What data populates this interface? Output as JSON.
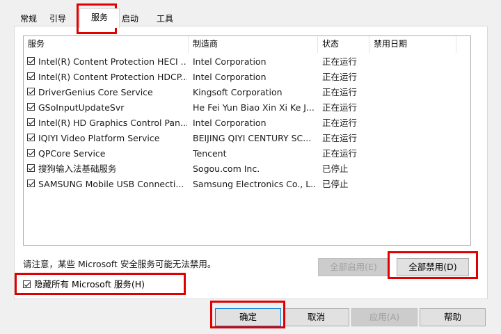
{
  "tabs": [
    {
      "label": "常规",
      "active": false
    },
    {
      "label": "引导",
      "active": false
    },
    {
      "label": "服务",
      "active": true
    },
    {
      "label": "启动",
      "active": false
    },
    {
      "label": "工具",
      "active": false
    }
  ],
  "columns": {
    "service": "服务",
    "manufacturer": "制造商",
    "status": "状态",
    "disabled_date": "禁用日期"
  },
  "services": [
    {
      "name": "Intel(R) Content Protection HECI ...",
      "manufacturer": "Intel Corporation",
      "status": "正在运行",
      "checked": true
    },
    {
      "name": "Intel(R) Content Protection HDCP...",
      "manufacturer": "Intel Corporation",
      "status": "正在运行",
      "checked": true
    },
    {
      "name": "DriverGenius Core Service",
      "manufacturer": "Kingsoft Corporation",
      "status": "正在运行",
      "checked": true
    },
    {
      "name": "GSoInputUpdateSvr",
      "manufacturer": "He Fei Yun Biao Xin Xi Ke J...",
      "status": "正在运行",
      "checked": true
    },
    {
      "name": "Intel(R) HD Graphics Control Pan...",
      "manufacturer": "Intel Corporation",
      "status": "正在运行",
      "checked": true
    },
    {
      "name": "IQIYI Video Platform Service",
      "manufacturer": "BEIJING QIYI CENTURY SC...",
      "status": "正在运行",
      "checked": true
    },
    {
      "name": "QPCore Service",
      "manufacturer": "Tencent",
      "status": "正在运行",
      "checked": true
    },
    {
      "name": "搜狗输入法基础服务",
      "manufacturer": "Sogou.com Inc.",
      "status": "已停止",
      "checked": true
    },
    {
      "name": "SAMSUNG Mobile USB Connecti...",
      "manufacturer": "Samsung Electronics Co., L...",
      "status": "已停止",
      "checked": true
    }
  ],
  "notice": "请注意，某些 Microsoft 安全服务可能无法禁用。",
  "buttons": {
    "enable_all": "全部启用(E)",
    "disable_all": "全部禁用(D)",
    "ok": "确定",
    "cancel": "取消",
    "apply": "应用(A)",
    "help": "帮助"
  },
  "hide_ms": {
    "label": "隐藏所有 Microsoft 服务(H)",
    "checked": true
  },
  "colors": {
    "highlight": "#e00000",
    "default_button_border": "#0078d7"
  }
}
